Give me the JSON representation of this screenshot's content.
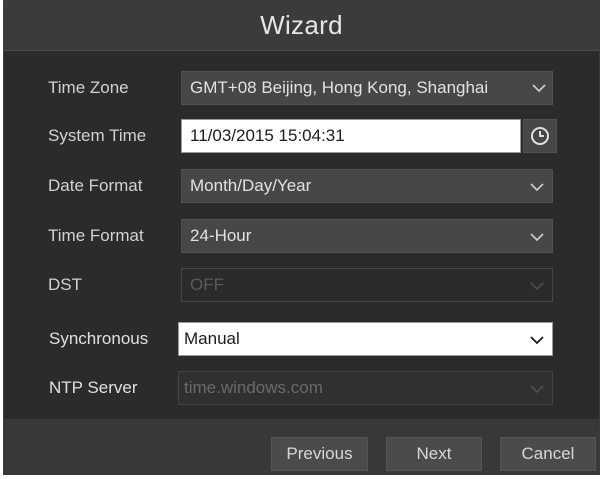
{
  "dialog": {
    "title": "Wizard"
  },
  "fields": {
    "time_zone": {
      "label": "Time Zone",
      "value": "GMT+08 Beijing, Hong Kong, Shanghai"
    },
    "system_time": {
      "label": "System Time",
      "value": "11/03/2015 15:04:31"
    },
    "date_format": {
      "label": "Date Format",
      "value": "Month/Day/Year"
    },
    "time_format": {
      "label": "Time Format",
      "value": "24-Hour"
    },
    "dst": {
      "label": "DST",
      "value": "OFF"
    },
    "synchronous": {
      "label": "Synchronous",
      "value": "Manual"
    },
    "ntp_server": {
      "label": "NTP Server",
      "value": "time.windows.com"
    }
  },
  "buttons": {
    "previous": "Previous",
    "next": "Next",
    "cancel": "Cancel"
  },
  "icons": {
    "clock": "clock-icon",
    "dropdown": "chevron-down-icon"
  },
  "colors": {
    "background": "#2b2b2b",
    "title_bar": "#3b3b3b",
    "field": "#474747",
    "footer": "#383838"
  }
}
